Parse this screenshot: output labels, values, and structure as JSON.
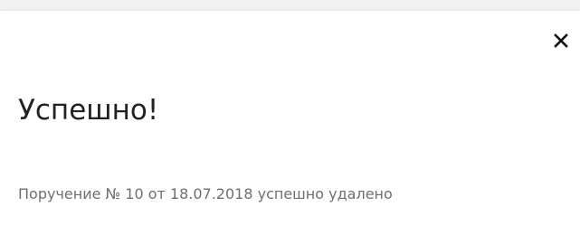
{
  "dialog": {
    "close_icon": "close-icon",
    "title": "Успешно!",
    "message": "Поручение № 10 от 18.07.2018 успешно удалено"
  }
}
